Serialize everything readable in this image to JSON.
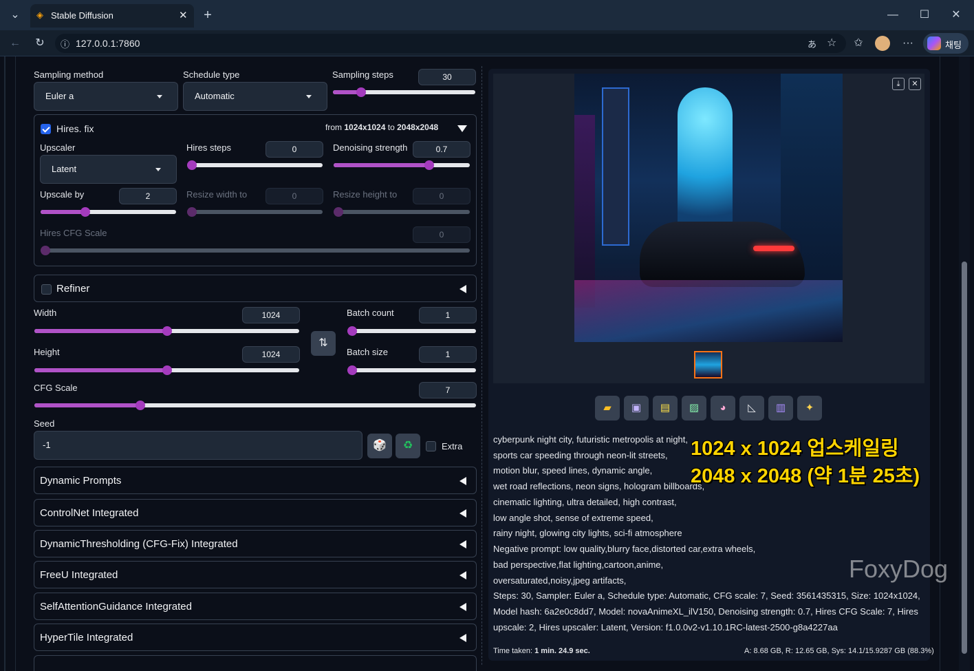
{
  "browser": {
    "tab_title": "Stable Diffusion",
    "url": "127.0.0.1:7860",
    "copilot_label": "채팅"
  },
  "sampling": {
    "method_label": "Sampling method",
    "method_value": "Euler a",
    "schedule_label": "Schedule type",
    "schedule_value": "Automatic",
    "steps_label": "Sampling steps",
    "steps_value": "30",
    "steps_fraction": 0.2
  },
  "hires": {
    "checkbox_label": "Hires. fix",
    "checked": true,
    "from_text": "from",
    "from_size": "1024x1024",
    "to_text": "to",
    "to_size": "2048x2048",
    "upscaler_label": "Upscaler",
    "upscaler_value": "Latent",
    "steps_label": "Hires steps",
    "steps_value": "0",
    "steps_fraction": 0,
    "denoise_label": "Denoising strength",
    "denoise_value": "0.7",
    "denoise_fraction": 0.7,
    "upscale_label": "Upscale by",
    "upscale_value": "2",
    "upscale_fraction": 0.33,
    "resize_w_label": "Resize width to",
    "resize_w_value": "0",
    "resize_h_label": "Resize height to",
    "resize_h_value": "0",
    "cfg_label": "Hires CFG Scale",
    "cfg_value": "0"
  },
  "refiner": {
    "label": "Refiner",
    "checked": false
  },
  "size": {
    "width_label": "Width",
    "width_value": "1024",
    "width_fraction": 0.5,
    "height_label": "Height",
    "height_value": "1024",
    "height_fraction": 0.5,
    "batch_count_label": "Batch count",
    "batch_count_value": "1",
    "batch_size_label": "Batch size",
    "batch_size_value": "1"
  },
  "cfg": {
    "label": "CFG Scale",
    "value": "7",
    "fraction": 0.24
  },
  "seed": {
    "label": "Seed",
    "value": "-1",
    "extra_label": "Extra"
  },
  "accordions": [
    "Dynamic Prompts",
    "ControlNet Integrated",
    "DynamicThresholding (CFG-Fix) Integrated",
    "FreeU Integrated",
    "SelfAttentionGuidance Integrated",
    "HyperTile Integrated"
  ],
  "toolbar_icons": [
    "folder-icon",
    "save-icon",
    "zip-icon",
    "image-icon",
    "palette-icon",
    "ruler-icon",
    "extras-icon",
    "sparkle-icon"
  ],
  "generation_info": [
    "cyberpunk night city, futuristic metropolis at night,",
    "sports car speeding through neon-lit streets,",
    "motion blur, speed lines, dynamic angle,",
    "wet road reflections, neon signs, hologram billboards,",
    "cinematic lighting, ultra detailed, high contrast,",
    "low angle shot, sense of extreme speed,",
    "rainy night, glowing city lights, sci-fi atmosphere",
    "Negative prompt: low quality,blurry face,distorted car,extra wheels,",
    "bad perspective,flat lighting,cartoon,anime,",
    "oversaturated,noisy,jpeg artifacts,",
    "Steps: 30, Sampler: Euler a, Schedule type: Automatic, CFG scale: 7, Seed: 3561435315, Size: 1024x1024,",
    "Model hash: 6a2e0c8dd7, Model: novaAnimeXL_ilV150, Denoising strength: 0.7, Hires CFG Scale: 7, Hires",
    "upscale: 2, Hires upscaler: Latent, Version: f1.0.0v2-v1.10.1RC-latest-2500-g8a4227aa"
  ],
  "time_taken_label": "Time taken:",
  "time_taken_value": "1 min. 24.9 sec.",
  "vram": "A: 8.68 GB, R: 12.65 GB, Sys: 14.1/15.9287 GB (88.3%)",
  "overlay": {
    "line1": "1024 x 1024 업스케일링",
    "line2": "2048 x 2048 (약 1분 25초)"
  },
  "watermark": "FoxyDog",
  "colors": {
    "accent": "#a43bbd",
    "bg": "#0b0f19",
    "highlight": "#ffd400"
  }
}
